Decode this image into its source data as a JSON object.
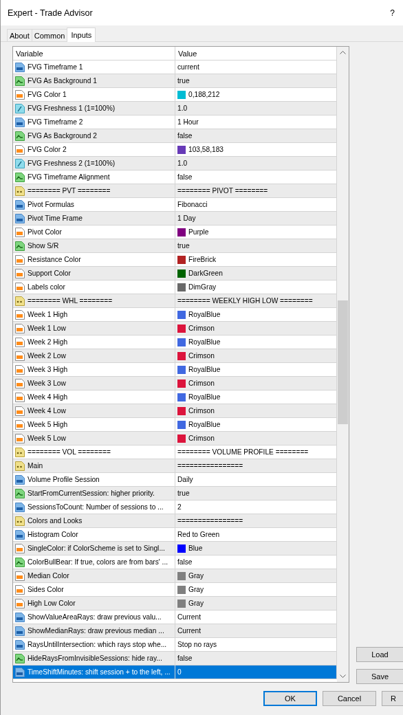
{
  "window": {
    "title": "Expert - Trade Advisor",
    "help": "?"
  },
  "tabs": [
    {
      "label": "About",
      "selected": false
    },
    {
      "label": "Common",
      "selected": false
    },
    {
      "label": "Inputs",
      "selected": true
    }
  ],
  "table": {
    "columns": [
      "Variable",
      "Value"
    ],
    "rows": [
      {
        "kind": "int",
        "variable": "FVG Timeframe 1",
        "value": "current",
        "selected": false
      },
      {
        "kind": "bool",
        "variable": "FVG As Background 1",
        "value": "true",
        "selected": false
      },
      {
        "kind": "color",
        "variable": "FVG Color 1",
        "value": "0,188,212",
        "color": "#00bcd4",
        "selected": false
      },
      {
        "kind": "double",
        "variable": "FVG Freshness 1 (1=100%)",
        "value": "1.0",
        "selected": false
      },
      {
        "kind": "int",
        "variable": "FVG Timeframe 2",
        "value": "1 Hour",
        "selected": false
      },
      {
        "kind": "bool",
        "variable": "FVG As Background 2",
        "value": "false",
        "selected": false
      },
      {
        "kind": "color",
        "variable": "FVG Color 2",
        "value": "103,58,183",
        "color": "#673ab7",
        "selected": false
      },
      {
        "kind": "double",
        "variable": "FVG Freshness 2 (1=100%)",
        "value": "1.0",
        "selected": false
      },
      {
        "kind": "bool",
        "variable": "FVG Timeframe Alignment",
        "value": "false",
        "selected": false
      },
      {
        "kind": "string",
        "variable": "======== PVT ========",
        "value": "======== PIVOT ========",
        "selected": false
      },
      {
        "kind": "int",
        "variable": "Pivot Formulas",
        "value": "Fibonacci",
        "selected": false
      },
      {
        "kind": "int",
        "variable": "Pivot Time Frame",
        "value": "1 Day",
        "selected": false
      },
      {
        "kind": "color",
        "variable": "Pivot Color",
        "value": "Purple",
        "color": "#800080",
        "selected": false
      },
      {
        "kind": "bool",
        "variable": "Show S/R",
        "value": "true",
        "selected": false
      },
      {
        "kind": "color",
        "variable": "Resistance Color",
        "value": "FireBrick",
        "color": "#b22222",
        "selected": false
      },
      {
        "kind": "color",
        "variable": "Support Color",
        "value": "DarkGreen",
        "color": "#006400",
        "selected": false
      },
      {
        "kind": "color",
        "variable": "Labels color",
        "value": "DimGray",
        "color": "#696969",
        "selected": false
      },
      {
        "kind": "string",
        "variable": "======== WHL ========",
        "value": "======== WEEKLY HIGH LOW ========",
        "selected": false
      },
      {
        "kind": "color",
        "variable": "Week 1 High",
        "value": "RoyalBlue",
        "color": "#4169e1",
        "selected": false
      },
      {
        "kind": "color",
        "variable": "Week 1 Low",
        "value": "Crimson",
        "color": "#dc143c",
        "selected": false
      },
      {
        "kind": "color",
        "variable": "Week 2 High",
        "value": "RoyalBlue",
        "color": "#4169e1",
        "selected": false
      },
      {
        "kind": "color",
        "variable": "Week 2 Low",
        "value": "Crimson",
        "color": "#dc143c",
        "selected": false
      },
      {
        "kind": "color",
        "variable": "Week 3 High",
        "value": "RoyalBlue",
        "color": "#4169e1",
        "selected": false
      },
      {
        "kind": "color",
        "variable": "Week 3 Low",
        "value": "Crimson",
        "color": "#dc143c",
        "selected": false
      },
      {
        "kind": "color",
        "variable": "Week 4 High",
        "value": "RoyalBlue",
        "color": "#4169e1",
        "selected": false
      },
      {
        "kind": "color",
        "variable": "Week 4 Low",
        "value": "Crimson",
        "color": "#dc143c",
        "selected": false
      },
      {
        "kind": "color",
        "variable": "Week 5 High",
        "value": "RoyalBlue",
        "color": "#4169e1",
        "selected": false
      },
      {
        "kind": "color",
        "variable": "Week 5 Low",
        "value": "Crimson",
        "color": "#dc143c",
        "selected": false
      },
      {
        "kind": "string",
        "variable": "======== VOL ========",
        "value": "======== VOLUME PROFILE ========",
        "selected": false
      },
      {
        "kind": "string",
        "variable": "Main",
        "value": "================",
        "selected": false
      },
      {
        "kind": "int",
        "variable": "Volume Profile Session",
        "value": "Daily",
        "selected": false
      },
      {
        "kind": "bool",
        "variable": "StartFromCurrentSession: higher priority.",
        "value": "true",
        "selected": false
      },
      {
        "kind": "int",
        "variable": "SessionsToCount: Number of sessions to ...",
        "value": "2",
        "selected": false
      },
      {
        "kind": "string",
        "variable": "Colors and Looks",
        "value": "================",
        "selected": false
      },
      {
        "kind": "int",
        "variable": "Histogram Color",
        "value": "Red to Green",
        "selected": false
      },
      {
        "kind": "color",
        "variable": "SingleColor: if ColorScheme is set to Singl...",
        "value": "Blue",
        "color": "#0000ff",
        "selected": false
      },
      {
        "kind": "bool",
        "variable": "ColorBullBear: If true, colors are from bars' ...",
        "value": "false",
        "selected": false
      },
      {
        "kind": "color",
        "variable": "Median Color",
        "value": "Gray",
        "color": "#808080",
        "selected": false
      },
      {
        "kind": "color",
        "variable": "Sides Color",
        "value": "Gray",
        "color": "#808080",
        "selected": false
      },
      {
        "kind": "color",
        "variable": "High Low Color",
        "value": "Gray",
        "color": "#808080",
        "selected": false
      },
      {
        "kind": "int",
        "variable": "ShowValueAreaRays: draw previous valu...",
        "value": "Current",
        "selected": false
      },
      {
        "kind": "int",
        "variable": "ShowMedianRays: draw previous median ...",
        "value": "Current",
        "selected": false
      },
      {
        "kind": "int",
        "variable": "RaysUntilIntersection: which rays stop whe...",
        "value": "Stop no rays",
        "selected": false
      },
      {
        "kind": "bool",
        "variable": "HideRaysFromInvisibleSessions: hide ray...",
        "value": "false",
        "selected": false
      },
      {
        "kind": "int",
        "variable": "TimeShiftMinutes: shift session + to the left, ...",
        "value": "0",
        "selected": true
      }
    ]
  },
  "side_buttons": [
    "Load",
    "Save"
  ],
  "buttons": [
    {
      "label": "OK",
      "default": true
    },
    {
      "label": "Cancel",
      "default": false
    },
    {
      "label": "R",
      "default": false
    }
  ]
}
